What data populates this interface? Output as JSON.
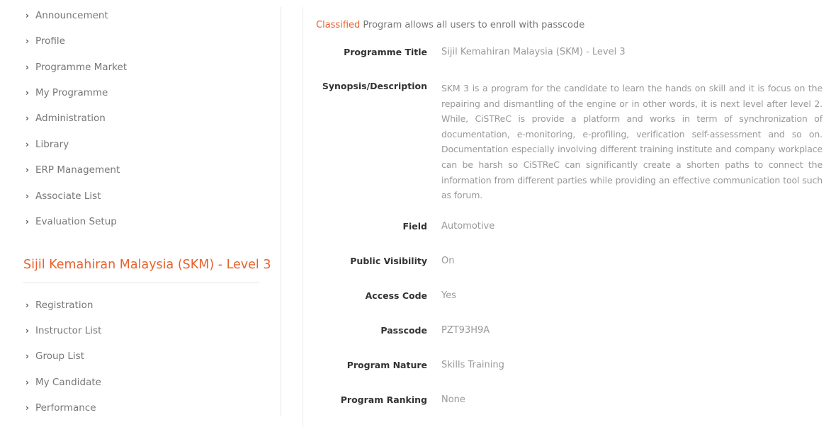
{
  "sidebar": {
    "menu": [
      {
        "label": "Announcement"
      },
      {
        "label": "Profile"
      },
      {
        "label": "Programme Market"
      },
      {
        "label": "My Programme"
      },
      {
        "label": "Administration"
      },
      {
        "label": "Library"
      },
      {
        "label": "ERP Management"
      },
      {
        "label": "Associate List"
      },
      {
        "label": "Evaluation Setup"
      }
    ],
    "section_title": "Sijil Kemahiran Malaysia (SKM) - Level 3",
    "section_menu": [
      {
        "label": "Registration"
      },
      {
        "label": "Instructor List"
      },
      {
        "label": "Group List"
      },
      {
        "label": "My Candidate"
      },
      {
        "label": "Performance"
      }
    ]
  },
  "main": {
    "notice_highlight": "Classified",
    "notice_rest": " Program allows all users to enroll with passcode",
    "details": {
      "programme_title": {
        "label": "Programme Title",
        "value": "Sijil Kemahiran Malaysia (SKM) - Level 3"
      },
      "synopsis": {
        "label": "Synopsis/Description",
        "value": "SKM 3 is a program for the candidate to learn the hands on skill and it is focus on the repairing and dismantling of the engine or in other words, it is next level after level 2. While, CiSTReC is provide a platform and works in term of synchronization of documentation, e-monitoring, e-profiling, verification self-assessment and so on. Documentation especially involving different training institute and company workplace can be harsh so CiSTReC can significantly create a shorten paths to connect the information from different parties while providing an effective communication tool such as forum."
      },
      "field": {
        "label": "Field",
        "value": "Automotive"
      },
      "public_visibility": {
        "label": "Public Visibility",
        "value": "On"
      },
      "access_code": {
        "label": "Access Code",
        "value": "Yes"
      },
      "passcode": {
        "label": "Passcode",
        "value": "PZT93H9A"
      },
      "program_nature": {
        "label": "Program Nature",
        "value": "Skills Training"
      },
      "program_ranking": {
        "label": "Program Ranking",
        "value": "None"
      }
    }
  }
}
